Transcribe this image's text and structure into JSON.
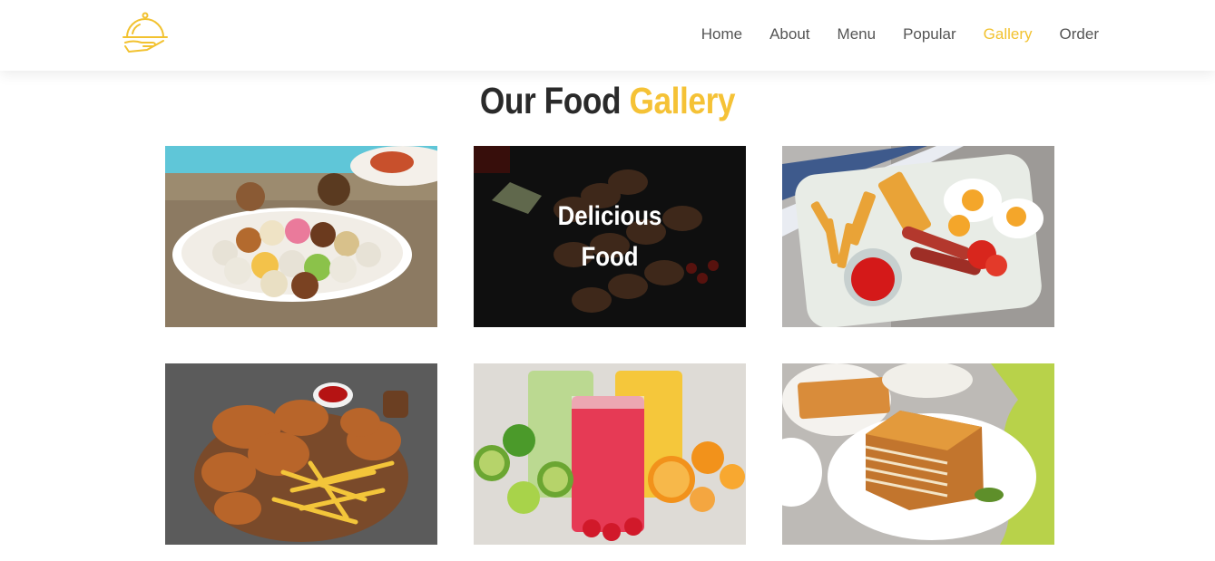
{
  "brand": {
    "logo_icon": "food-cloche-icon",
    "accent_color": "#f5c236"
  },
  "nav": {
    "items": [
      {
        "label": "Home",
        "active": false
      },
      {
        "label": "About",
        "active": false
      },
      {
        "label": "Menu",
        "active": false
      },
      {
        "label": "Popular",
        "active": false
      },
      {
        "label": "Gallery",
        "active": true
      },
      {
        "label": "Order",
        "active": false
      }
    ]
  },
  "section": {
    "title_main": "Our Food",
    "title_accent": "Gallery"
  },
  "gallery": {
    "overlay_text": "Delicious Food",
    "images": [
      {
        "name": "sweets-platter"
      },
      {
        "name": "grilled-skewers"
      },
      {
        "name": "breakfast-plate"
      },
      {
        "name": "fried-chicken-fries"
      },
      {
        "name": "fruit-smoothies"
      },
      {
        "name": "honey-cake"
      }
    ]
  }
}
